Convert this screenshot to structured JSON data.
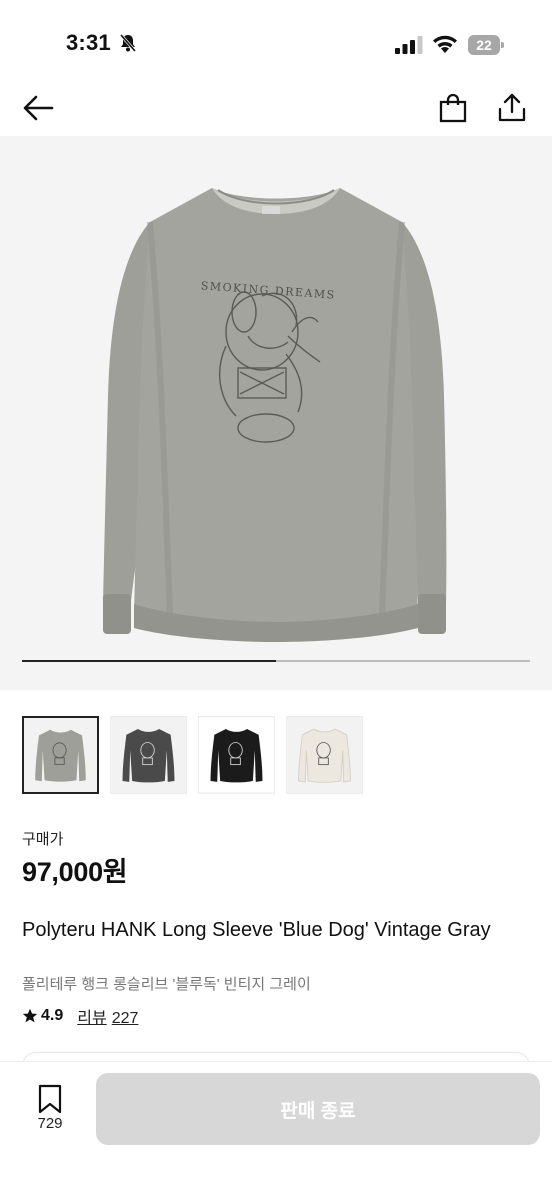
{
  "status_bar": {
    "time": "3:31",
    "battery_level": "22",
    "battery_fraction": 0.22
  },
  "nav": {
    "back_icon": "arrow-left-icon",
    "bag_icon": "shopping-bag-icon",
    "share_icon": "share-icon"
  },
  "hero": {
    "print_text": "SMOKING DREAMS",
    "carousel_progress_fraction": 0.5
  },
  "thumbnails": [
    {
      "color": "#9d9f98",
      "selected": true
    },
    {
      "color": "#4a4a4a",
      "selected": false
    },
    {
      "color": "#1b1b1b",
      "selected": false
    },
    {
      "color": "#ece8e0",
      "selected": false
    }
  ],
  "product": {
    "price_label": "구매가",
    "price": "97,000원",
    "title_en": "Polyteru HANK Long Sleeve 'Blue Dog' Vintage Gray",
    "title_ko": "폴리테루 행크 롱슬리브 '블루독' 빈티지 그레이",
    "rating": "4.9",
    "review_label": "리뷰",
    "review_count": "227"
  },
  "bottom_bar": {
    "wish_count": "729",
    "buy_button_label": "판매 종료"
  },
  "colors": {
    "accent_text": "#111111",
    "disabled_button": "#d7d7d7",
    "shirt_gray": "#9d9f98"
  }
}
